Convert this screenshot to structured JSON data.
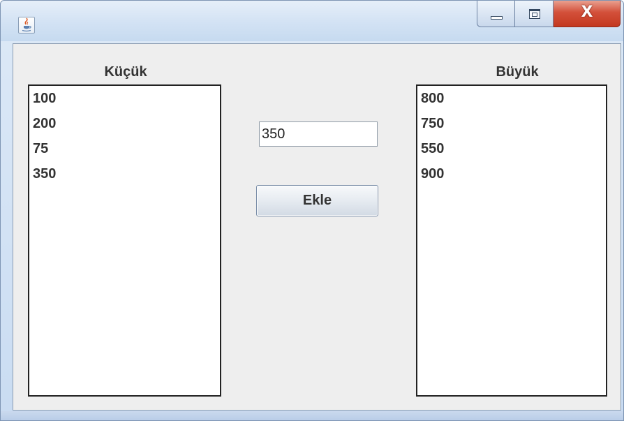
{
  "window": {
    "title": "",
    "icon": "java-cup-icon",
    "controls": {
      "minimize_icon": "minimize-icon",
      "maximize_icon": "maximize-icon",
      "close_label": "X"
    }
  },
  "left_panel": {
    "label": "Küçük",
    "items": [
      "100",
      "200",
      "75",
      "350"
    ]
  },
  "right_panel": {
    "label": "Büyük",
    "items": [
      "800",
      "750",
      "550",
      "900"
    ]
  },
  "input": {
    "value": "350"
  },
  "add_button": {
    "label": "Ekle"
  },
  "colors": {
    "close_button": "#c94a33",
    "panel_background": "#eeeeee",
    "title_bar": "#d4e3f4"
  }
}
